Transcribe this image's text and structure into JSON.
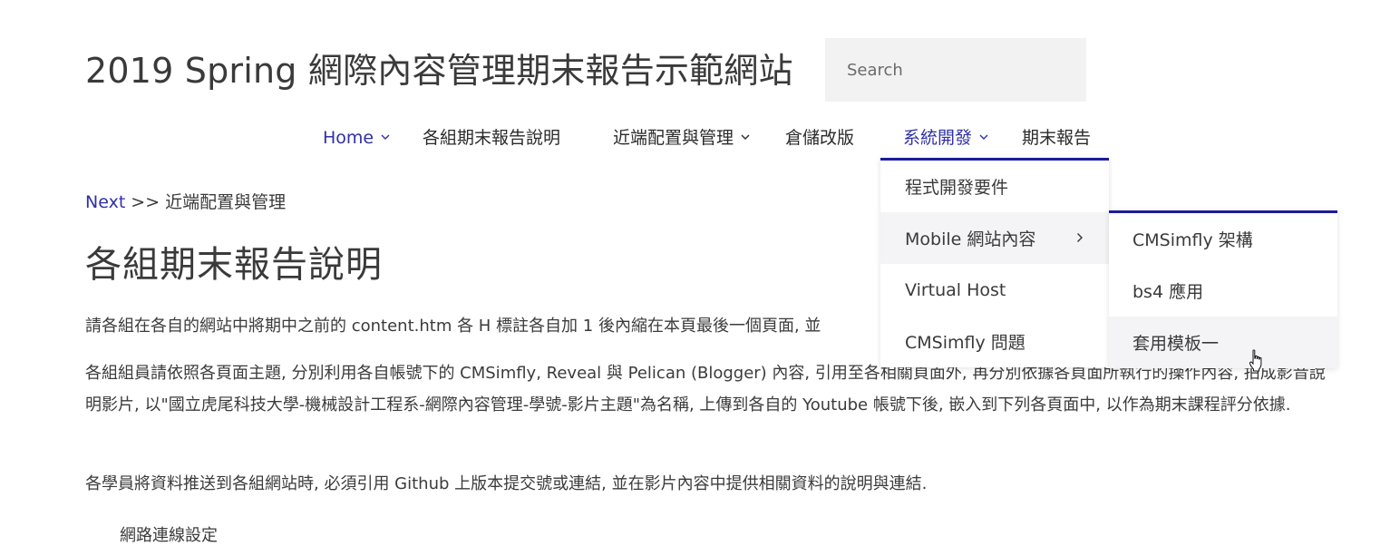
{
  "site": {
    "title": "2019 Spring 網際內容管理期末報告示範網站"
  },
  "search": {
    "placeholder": "Search"
  },
  "nav": {
    "items": [
      {
        "label": "Home",
        "has_caret": true
      },
      {
        "label": "各組期末報告說明",
        "has_caret": false
      },
      {
        "label": "近端配置與管理",
        "has_caret": true
      },
      {
        "label": "倉儲改版",
        "has_caret": false
      },
      {
        "label": "系統開發",
        "has_caret": true
      },
      {
        "label": "期末報告",
        "has_caret": false
      }
    ],
    "caret_icon": "chevron-down-icon"
  },
  "dropdown": {
    "items": [
      {
        "label": "程式開發要件"
      },
      {
        "label": "Mobile 網站內容",
        "has_submenu": true
      },
      {
        "label": "Virtual Host"
      },
      {
        "label": "CMSimfly 問題"
      }
    ],
    "arrow_icon": "chevron-right-icon"
  },
  "submenu": {
    "items": [
      {
        "label": "CMSimfly 架構"
      },
      {
        "label": "bs4 應用"
      },
      {
        "label": "套用模板一"
      }
    ]
  },
  "breadcrumb": {
    "next": "Next",
    "rest": " >> 近端配置與管理"
  },
  "page": {
    "title": "各組期末報告說明"
  },
  "content": {
    "p1": "請各組在各自的網站中將期中之前的 content.htm 各 H 標註各自加 1 後內縮在本頁最後一個頁面, 並",
    "p2": "各組組員請依照各頁面主題, 分別利用各自帳號下的 CMSimfly, Reveal 與 Pelican (Blogger) 內容, 引用至各相關頁面外, 再分別依據各頁面所執行的操作內容, 拍成影音說明影片, 以\"國立虎尾科技大學-機械設計工程系-網際內容管理-學號-影片主題\"為名稱, 上傳到各自的 Youtube 帳號下後, 嵌入到下列各頁面中, 以作為期末課程評分依據.",
    "p3": "各學員將資料推送到各組網站時, 必須引用 Github 上版本提交號或連結, 並在影片內容中提供相關資料的說明與連結.",
    "list_item": "網路連線設定"
  },
  "colors": {
    "accent": "#1c1c9a",
    "link": "#3030a8",
    "hover_bg": "#f4f4f7",
    "search_bg": "#f2f2f2"
  }
}
